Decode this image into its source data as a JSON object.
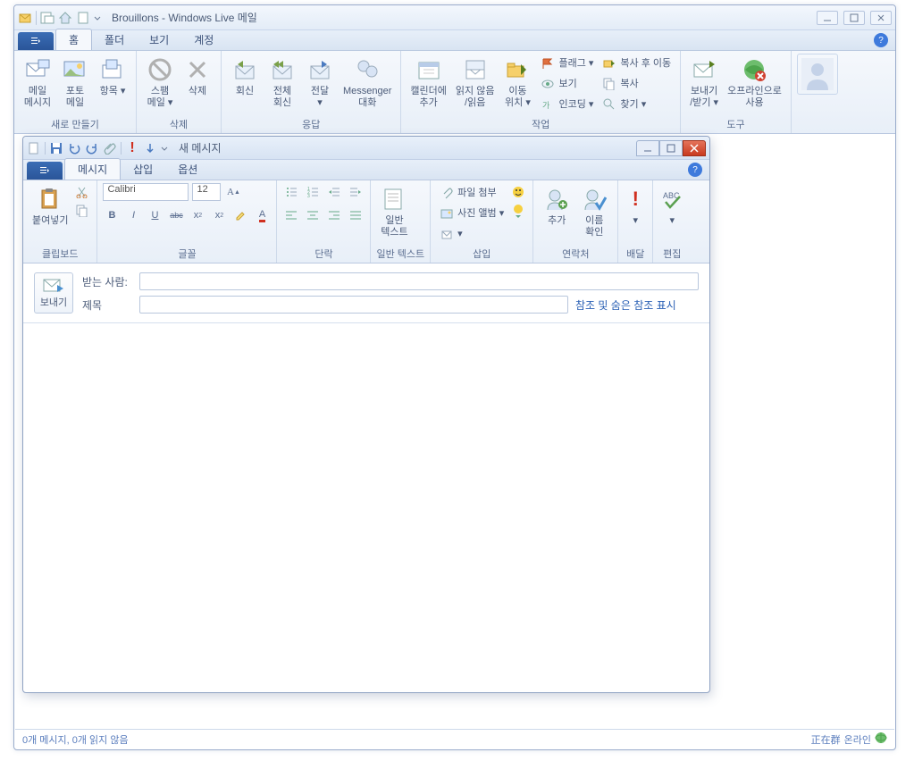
{
  "main": {
    "title": "Brouillons - Windows Live 메일",
    "tabs": {
      "home": "홈",
      "folder": "폴더",
      "view": "보기",
      "account": "계정"
    },
    "ribbon": {
      "new": {
        "label": "새로 만들기",
        "mail": "메일\n메시지",
        "photo": "포토\n메일",
        "item": "항목"
      },
      "delete": {
        "label": "삭제",
        "spam": "스팸\n메일",
        "del": "삭제"
      },
      "respond": {
        "label": "응답",
        "reply": "회신",
        "replyall": "전체\n회신",
        "forward": "전달",
        "im": "Messenger\n대화"
      },
      "actions": {
        "label": "작업",
        "calendar": "캘린더에\n추가",
        "unread": "읽지 않음\n/읽음",
        "move": "이동\n위치",
        "flag": "플래그",
        "view": "보기",
        "copymove": "복사 후 이동",
        "copy": "복사",
        "encoding": "인코딩",
        "find": "찾기"
      },
      "tools": {
        "label": "도구",
        "sendrecv": "보내기\n/받기",
        "offline": "오프라인으로\n사용"
      }
    }
  },
  "compose": {
    "title": "새 메시지",
    "tabs": {
      "message": "메시지",
      "insert": "삽입",
      "options": "옵션"
    },
    "ribbon": {
      "clipboard": {
        "label": "클립보드",
        "paste": "붙여넣기"
      },
      "font": {
        "label": "글꼴",
        "name": "Calibri",
        "size": "12"
      },
      "para": {
        "label": "단락"
      },
      "plaintext": {
        "label": "일반 텍스트",
        "btn": "일반\n텍스트"
      },
      "insert": {
        "label": "삽입",
        "attach": "파일 첨부",
        "album": "사진 앨범"
      },
      "contacts": {
        "label": "연락처",
        "add": "추가",
        "check": "이름\n확인"
      },
      "delivery": {
        "label": "배달"
      },
      "editing": {
        "label": "편집"
      }
    },
    "send": "보내기",
    "to_label": "받는 사람:",
    "subject_label": "제목",
    "cc_link": "참조 및 숨은 참조 표시"
  },
  "status": {
    "left": "0개 메시지, 0개 읽지 않음",
    "right_prefix": "正在群",
    "right": "온라인"
  }
}
